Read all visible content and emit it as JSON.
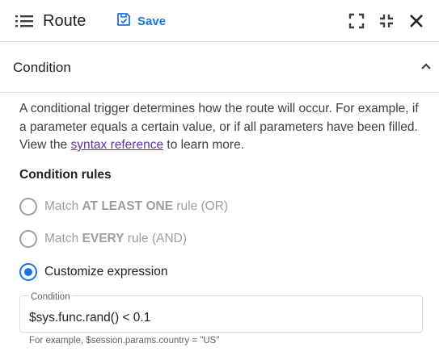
{
  "header": {
    "title": "Route",
    "save_label": "Save",
    "icons": [
      "list-icon",
      "save-icon",
      "fullscreen-icon",
      "collapse-icon",
      "close-icon"
    ]
  },
  "section": {
    "title": "Condition",
    "expanded": true,
    "description_before": "A conditional trigger determines how the route will occur. For example, if a parameter equals a certain value, or if all parameters have been filled. View the ",
    "link_text": "syntax reference",
    "description_after": " to learn more."
  },
  "rules": {
    "label": "Condition rules",
    "options": [
      {
        "prefix": "Match ",
        "bold": "AT LEAST ONE",
        "suffix": " rule (OR)",
        "selected": false
      },
      {
        "prefix": "Match ",
        "bold": "EVERY",
        "suffix": " rule (AND)",
        "selected": false
      },
      {
        "prefix": "Customize expression",
        "bold": "",
        "suffix": "",
        "selected": true
      }
    ]
  },
  "condition_field": {
    "label": "Condition",
    "value": "$sys.func.rand() < 0.1",
    "hint": "For example, $session.params.country = \"US\""
  },
  "colors": {
    "accent": "#1a73e8",
    "link": "#5e35b1",
    "divider": "#e0e0e0",
    "disabled": "#9e9e9e"
  }
}
